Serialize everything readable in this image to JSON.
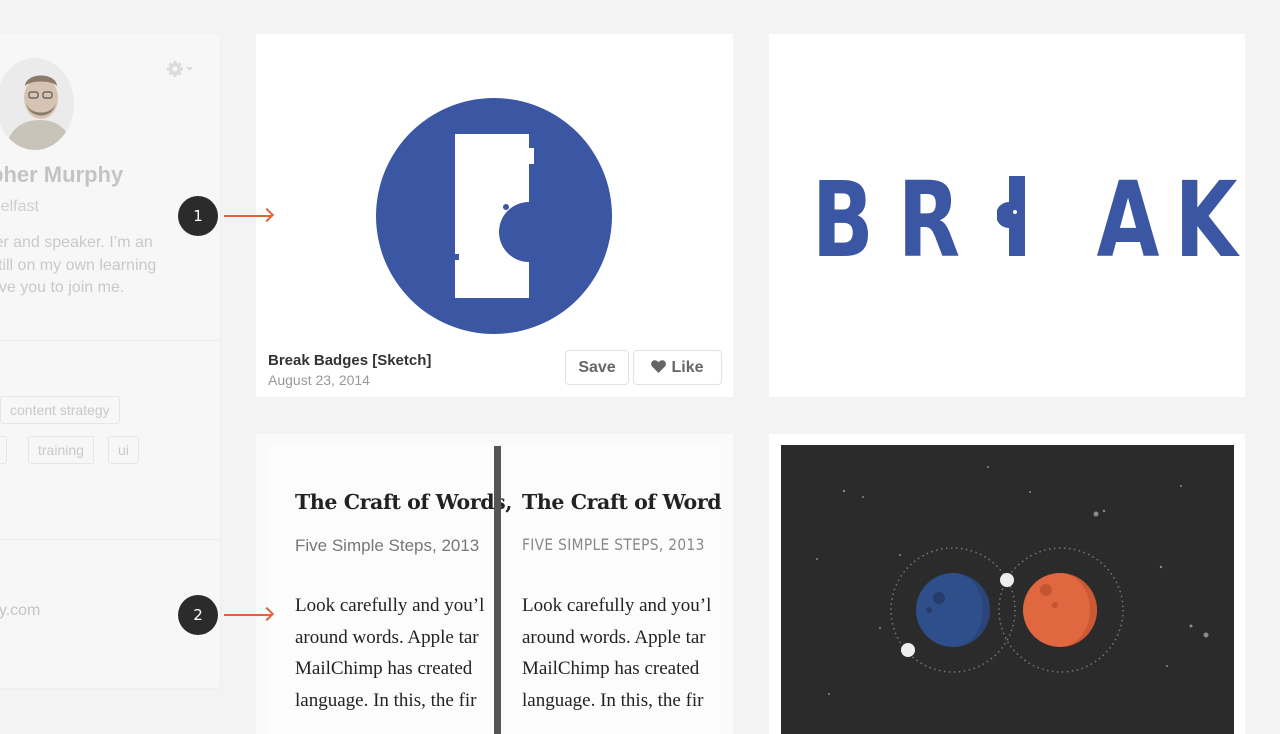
{
  "profile": {
    "name": "pher Murphy",
    "location": "Belfast",
    "bio_lines": [
      "ter and speaker. I’m an",
      "still on my own learning",
      "ove you to join me."
    ],
    "tags": [
      "content strategy",
      "y",
      "training",
      "ui"
    ],
    "website": "hy.com"
  },
  "cards": [
    {
      "title": "Break Badges [Sketch]",
      "date": "August 23, 2014",
      "save_label": "Save",
      "like_label": "Like",
      "accent_color": "#3b57a3"
    },
    {
      "wordmark": [
        "B",
        "R",
        "A",
        "K"
      ],
      "accent_color": "#3b57a3"
    },
    {
      "book_title": "The Craft of Words,",
      "subtitle_left": "Five Simple Steps, 2013",
      "subtitle_right": "FIVE SIMPLE STEPS, 2013",
      "body_lines": [
        "Look carefully and you’l",
        "around words. Apple tar",
        "MailChimp has created",
        "language. In this, the fir"
      ]
    },
    {
      "planet_colors": [
        "#2f4f8a",
        "#e0673f"
      ],
      "background_color": "#2b2b2b"
    }
  ],
  "annotations": [
    "1",
    "2"
  ]
}
